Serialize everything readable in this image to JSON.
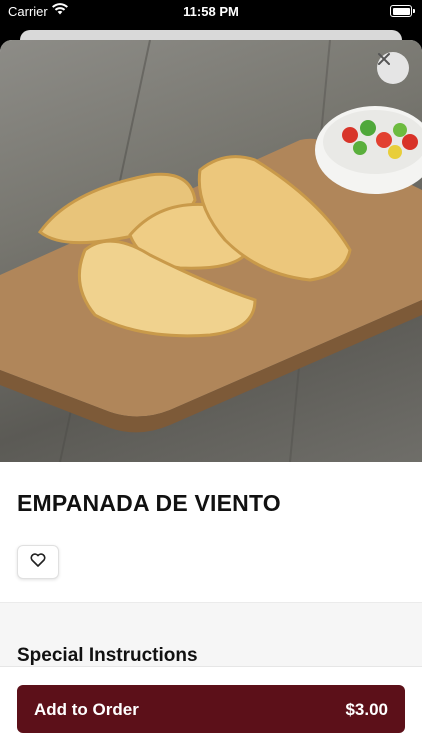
{
  "status_bar": {
    "carrier": "Carrier",
    "time": "11:58 PM"
  },
  "item": {
    "title": "EMPANADA DE VIENTO"
  },
  "icons": {
    "close": "close-icon",
    "favorite": "heart-icon",
    "wifi": "wifi-icon",
    "battery": "battery-icon"
  },
  "sections": {
    "special_instructions_title": "Special Instructions"
  },
  "footer": {
    "add_label": "Add to Order",
    "price": "$3.00"
  },
  "colors": {
    "accent": "#5c1019"
  }
}
